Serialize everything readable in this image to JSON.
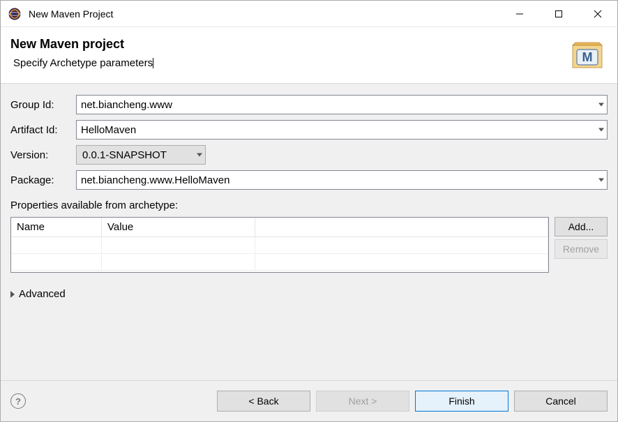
{
  "window": {
    "title": "New Maven Project"
  },
  "header": {
    "title": "New Maven project",
    "subtitle": "Specify Archetype parameters"
  },
  "form": {
    "groupIdLabel": "Group Id:",
    "groupId": "net.biancheng.www",
    "artifactIdLabel": "Artifact Id:",
    "artifactId": "HelloMaven",
    "versionLabel": "Version:",
    "version": "0.0.1-SNAPSHOT",
    "packageLabel": "Package:",
    "package": "net.biancheng.www.HelloMaven"
  },
  "properties": {
    "label": "Properties available from archetype:",
    "columns": {
      "name": "Name",
      "value": "Value"
    },
    "addLabel": "Add...",
    "removeLabel": "Remove"
  },
  "advanced": {
    "label": "Advanced"
  },
  "footer": {
    "back": "< Back",
    "next": "Next >",
    "finish": "Finish",
    "cancel": "Cancel"
  }
}
